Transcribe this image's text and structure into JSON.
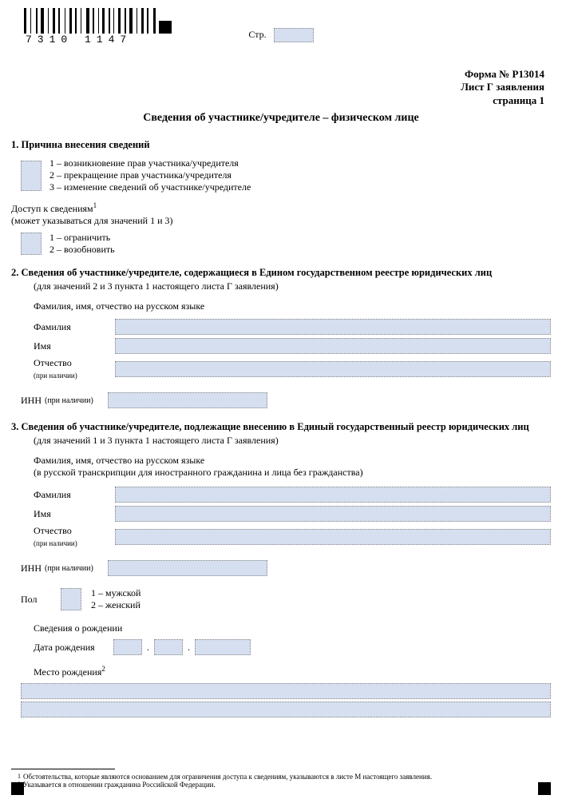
{
  "barcode_number": "7310 1147",
  "page_label": "Стр.",
  "page_number": "",
  "form_code": "Форма № Р13014",
  "sheet_label": "Лист Г заявления",
  "page_of": "страница 1",
  "title": "Сведения об участнике/учредителе – физическом лице",
  "section1": {
    "heading": "1. Причина внесения сведений",
    "opt1": "1 – возникновение прав участника/учредителя",
    "opt2": "2 – прекращение прав участника/учредителя",
    "opt3": "3 – изменение сведений об участнике/учредителе",
    "access_heading": "Доступ к сведениям",
    "access_note": "(может указываться для значений 1 и 3)",
    "access_sup": "1",
    "access_opt1": "1 – ограничить",
    "access_opt2": "2 – возобновить"
  },
  "section2": {
    "heading": "2. Сведения об участнике/учредителе, содержащиеся в Едином государственном реестре юридических лиц",
    "note": "(для значений 2 и 3 пункта 1 настоящего листа Г заявления)",
    "fio_label": "Фамилия, имя, отчество на русском языке",
    "surname": "Фамилия",
    "name": "Имя",
    "patronymic": "Отчество",
    "patronymic_note": "(при наличии)",
    "inn": "ИНН",
    "inn_note": "(при наличии)"
  },
  "section3": {
    "heading": "3. Сведения об участнике/учредителе, подлежащие внесению в Единый государственный реестр юридических лиц",
    "note": "(для значений 1 и 3 пункта 1 настоящего листа Г заявления)",
    "fio_label": "Фамилия, имя, отчество на русском языке",
    "fio_note": "(в русской транскрипции для иностранного гражданина и лица без гражданства)",
    "surname": "Фамилия",
    "name": "Имя",
    "patronymic": "Отчество",
    "patronymic_note": "(при наличии)",
    "inn": "ИНН",
    "inn_note": "(при наличии)",
    "gender": "Пол",
    "gender_opt1": "1 – мужской",
    "gender_opt2": "2 – женский",
    "birth_heading": "Сведения о рождении",
    "birth_date": "Дата рождения",
    "birth_place": "Место рождения",
    "birth_place_sup": "2"
  },
  "footnotes": {
    "f1": "Обстоятельства, которые являются основанием для ограничения доступа к сведениям, указываются в листе М настоящего заявления.",
    "f2": "Указывается в отношении гражданина Российской Федерации."
  }
}
